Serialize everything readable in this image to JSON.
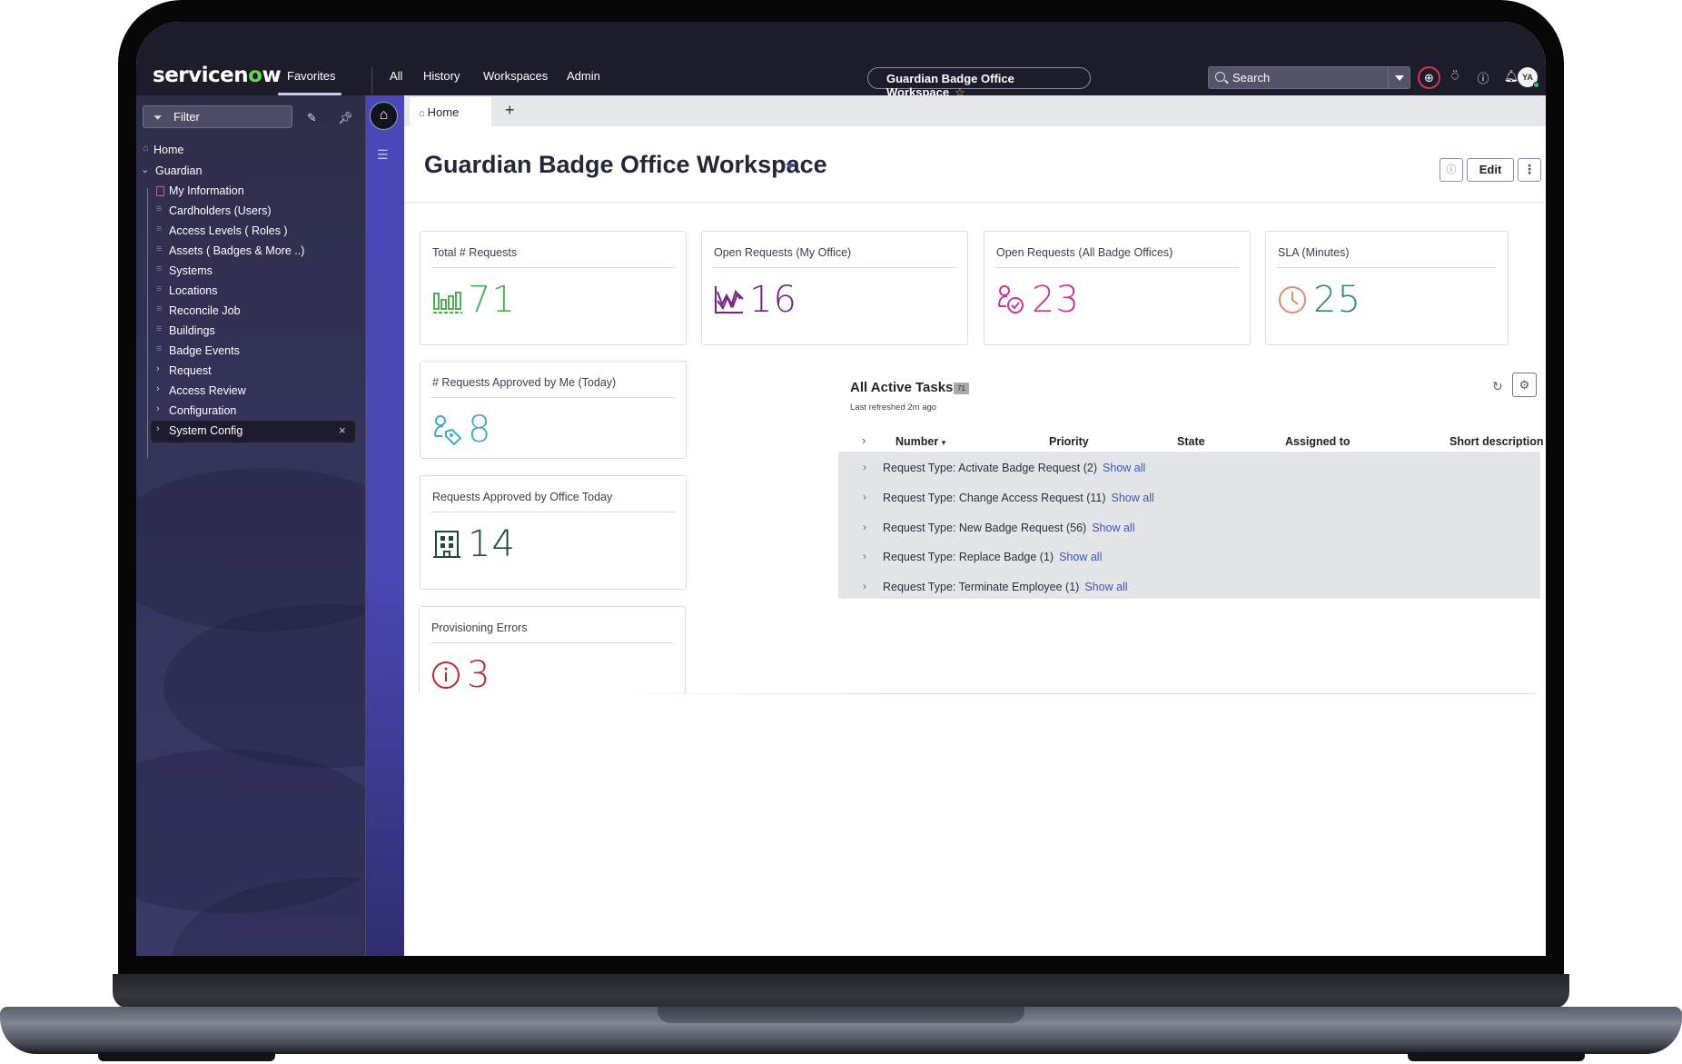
{
  "topnav": {
    "logo_prefix": "servicen",
    "logo_o": "o",
    "logo_suffix": "w",
    "items": [
      "Favorites",
      "All",
      "History",
      "Workspaces",
      "Admin"
    ],
    "workspace_pill": "Guardian Badge Office Workspace",
    "search_placeholder": "Search",
    "avatar_initials": "YA",
    "icons": [
      "globe-icon",
      "chat-icon",
      "help-icon",
      "bell-icon"
    ]
  },
  "sidebar": {
    "filter_placeholder": "Filter",
    "items": [
      {
        "label": "Home",
        "icon": "home-icon",
        "level": 0
      },
      {
        "label": "Guardian",
        "icon": "chevron-down-icon",
        "level": 0
      },
      {
        "label": "My Information",
        "icon": "contact-book-icon",
        "level": 1
      },
      {
        "label": "Cardholders (Users)",
        "icon": "list-icon",
        "level": 1
      },
      {
        "label": "Access Levels ( Roles )",
        "icon": "list-icon",
        "level": 1
      },
      {
        "label": "Assets ( Badges & More ..)",
        "icon": "list-icon",
        "level": 1
      },
      {
        "label": "Systems",
        "icon": "list-icon",
        "level": 1
      },
      {
        "label": "Locations",
        "icon": "list-icon",
        "level": 1
      },
      {
        "label": "Reconcile Job",
        "icon": "list-icon",
        "level": 1
      },
      {
        "label": "Buildings",
        "icon": "list-icon",
        "level": 1
      },
      {
        "label": "Badge Events",
        "icon": "list-icon",
        "level": 1
      },
      {
        "label": "Request",
        "icon": "chevron-right-icon",
        "level": 1
      },
      {
        "label": "Access Review",
        "icon": "chevron-right-icon",
        "level": 1
      },
      {
        "label": "Configuration",
        "icon": "chevron-right-icon",
        "level": 1
      },
      {
        "label": "System Config",
        "icon": "chevron-right-icon",
        "level": 1,
        "active": true
      }
    ]
  },
  "tabs": [
    {
      "label": "Home"
    }
  ],
  "page": {
    "title": "Guardian Badge Office Workspace",
    "edit_label": "Edit"
  },
  "cards": [
    {
      "title": "Total # Requests",
      "value": "71",
      "icon": "bar-chart-icon",
      "color": "#4caf50"
    },
    {
      "title": "Open Requests (My Office)",
      "value": "16",
      "icon": "line-chart-icon",
      "color": "#7b1f8a"
    },
    {
      "title": "Open Requests (All Badge Offices)",
      "value": "23",
      "icon": "user-check-icon",
      "color": "#c8349b"
    },
    {
      "title": "SLA (Minutes)",
      "value": "25",
      "icon": "clock-icon",
      "color": "#2e8a83",
      "icon_color": "#e58a6a"
    },
    {
      "title": "# Requests Approved by Me (Today)",
      "value": "8",
      "icon": "user-tag-icon",
      "color": "#3fa9d4"
    },
    {
      "title": "Requests Approved by Office Today",
      "value": "14",
      "icon": "building-icon",
      "color": "#1f4a36"
    },
    {
      "title": "Provisioning Errors",
      "value": "3",
      "icon": "info-circle-icon",
      "color": "#b72a32"
    }
  ],
  "tasks": {
    "title": "All Active Tasks",
    "count": "71",
    "refreshed": "Last refreshed 2m ago",
    "columns": [
      "Number",
      "Priority",
      "State",
      "Assigned to",
      "Short description"
    ],
    "groups": [
      {
        "label": "Request Type: Activate Badge Request (2)",
        "link": "Show all"
      },
      {
        "label": "Request Type: Change Access Request (11)",
        "link": "Show all"
      },
      {
        "label": "Request Type: New Badge Request (56)",
        "link": "Show all"
      },
      {
        "label": "Request Type: Replace Badge (1)",
        "link": "Show all"
      },
      {
        "label": "Request Type: Terminate Employee (1)",
        "link": "Show all"
      }
    ]
  }
}
